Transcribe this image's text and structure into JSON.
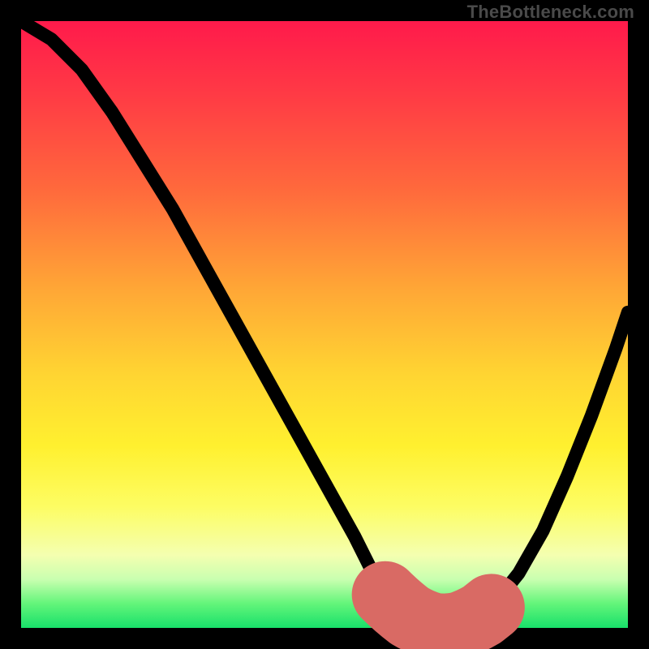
{
  "watermark": "TheBottleneck.com",
  "colors": {
    "frame_bg": "#000000",
    "curve": "#000000",
    "highlight": "#d96a64",
    "gradient_top": "#ff1a4b",
    "gradient_bottom": "#18e06a"
  },
  "chart_data": {
    "type": "line",
    "title": "",
    "xlabel": "",
    "ylabel": "",
    "xlim": [
      0,
      100
    ],
    "ylim": [
      0,
      100
    ],
    "grid": false,
    "legend": false,
    "annotations": [
      "TheBottleneck.com"
    ],
    "series": [
      {
        "name": "bottleneck-curve",
        "x": [
          0,
          5,
          10,
          15,
          20,
          25,
          30,
          35,
          40,
          45,
          50,
          55,
          58,
          62,
          66,
          70,
          74,
          78,
          82,
          86,
          90,
          94,
          98,
          100
        ],
        "y": [
          100,
          97,
          92,
          85,
          77,
          69,
          60,
          51,
          42,
          33,
          24,
          15,
          9,
          4,
          1,
          0,
          0,
          2,
          7,
          14,
          23,
          33,
          44,
          50
        ]
      },
      {
        "name": "optimal-range-highlight",
        "x": [
          58,
          62,
          66,
          70,
          74,
          77
        ],
        "y": [
          7,
          3,
          1,
          0,
          1,
          3
        ]
      }
    ],
    "highlight_marker": {
      "x": 58,
      "y": 7
    }
  }
}
